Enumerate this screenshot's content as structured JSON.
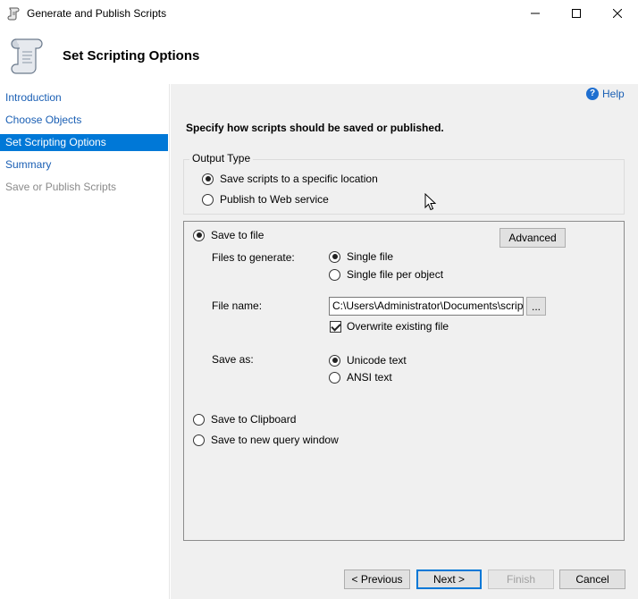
{
  "window": {
    "title": "Generate and Publish Scripts",
    "minimize_glyph": "—",
    "maximize_glyph": "☐",
    "close_glyph": "✕"
  },
  "header": {
    "title": "Set Scripting Options",
    "icon": "scroll-icon"
  },
  "sidebar": {
    "items": [
      {
        "label": "Introduction",
        "state": "link"
      },
      {
        "label": "Choose Objects",
        "state": "link"
      },
      {
        "label": "Set Scripting Options",
        "state": "active"
      },
      {
        "label": "Summary",
        "state": "link"
      },
      {
        "label": "Save or Publish Scripts",
        "state": "disabled"
      }
    ]
  },
  "help": {
    "label": "Help",
    "icon": "help-icon"
  },
  "instruction": "Specify how scripts should be saved or published.",
  "output_type": {
    "legend": "Output Type",
    "options": [
      {
        "label": "Save scripts to a specific location",
        "selected": true
      },
      {
        "label": "Publish to Web service",
        "selected": false
      }
    ]
  },
  "save_to_file": {
    "label": "Save to file",
    "selected": true,
    "advanced_label": "Advanced",
    "files_to_generate_label": "Files to generate:",
    "files_options": [
      {
        "label": "Single file",
        "selected": true
      },
      {
        "label": "Single file per object",
        "selected": false
      }
    ],
    "file_name_label": "File name:",
    "file_name_value": "C:\\Users\\Administrator\\Documents\\script.sql",
    "browse_label": "...",
    "overwrite_label": "Overwrite existing file",
    "overwrite_checked": true,
    "save_as_label": "Save as:",
    "save_as_options": [
      {
        "label": "Unicode text",
        "selected": true
      },
      {
        "label": "ANSI text",
        "selected": false
      }
    ]
  },
  "other_outputs": [
    {
      "label": "Save to Clipboard",
      "selected": false
    },
    {
      "label": "Save to new query window",
      "selected": false
    }
  ],
  "footer": {
    "previous_label": "< Previous",
    "next_label": "Next >",
    "finish_label": "Finish",
    "cancel_label": "Cancel"
  },
  "colors": {
    "accent": "#0078d7",
    "link": "#1a5fb4",
    "panel_bg": "#f0f0f0"
  }
}
